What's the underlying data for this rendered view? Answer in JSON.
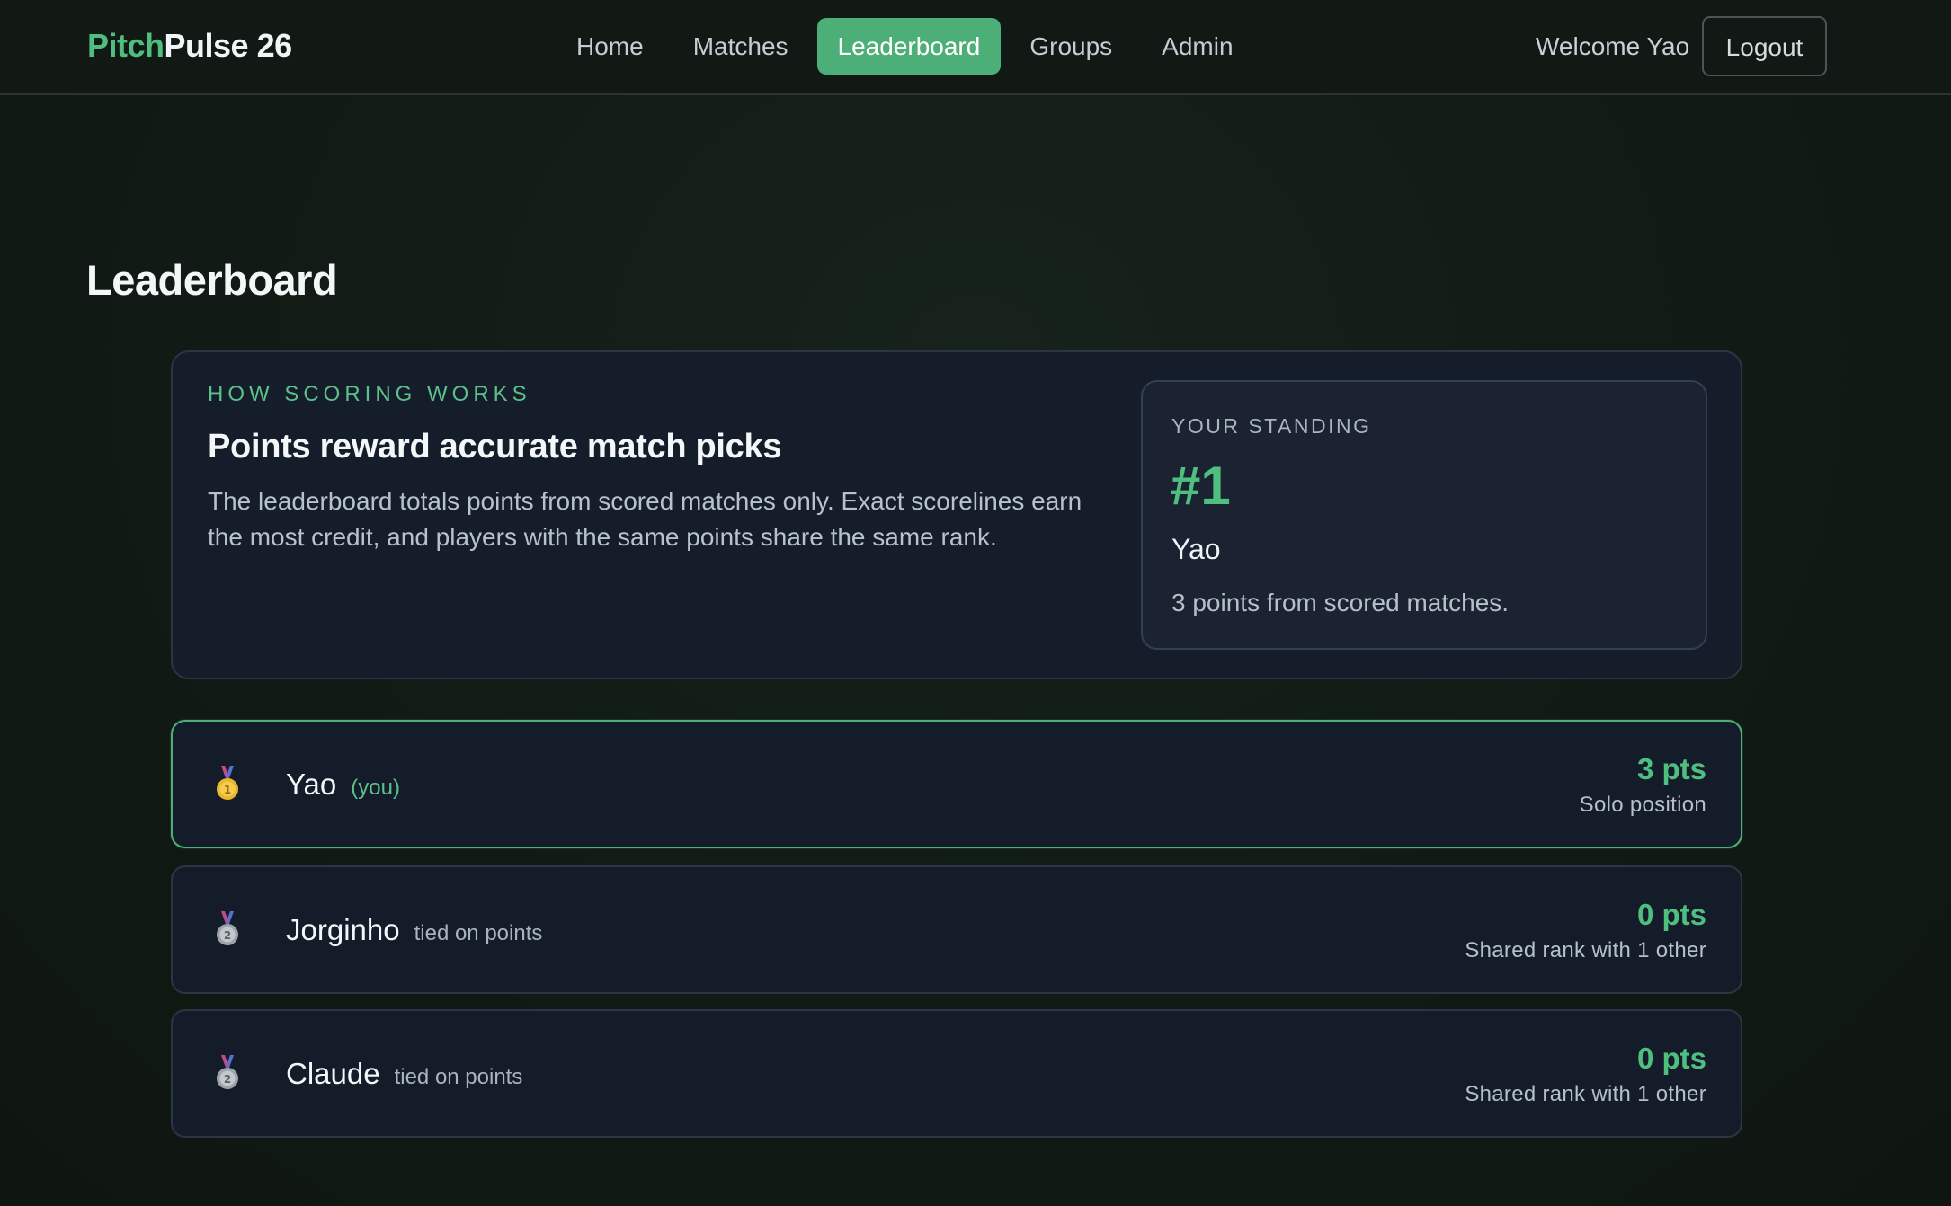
{
  "brand": {
    "part1": "Pitch",
    "part2": "Pulse 26"
  },
  "nav": {
    "items": [
      {
        "label": "Home"
      },
      {
        "label": "Matches"
      },
      {
        "label": "Leaderboard",
        "active": true
      },
      {
        "label": "Groups"
      },
      {
        "label": "Admin"
      }
    ]
  },
  "user": {
    "welcome": "Welcome Yao",
    "logout_label": "Logout"
  },
  "page": {
    "title": "Leaderboard"
  },
  "scoring": {
    "eyebrow": "HOW SCORING WORKS",
    "heading": "Points reward accurate match picks",
    "body": "The leaderboard totals points from scored matches only. Exact scorelines earn the most credit, and players with the same points share the same rank."
  },
  "standing": {
    "label": "YOUR STANDING",
    "rank": "#1",
    "name": "Yao",
    "summary": "3 points from scored matches."
  },
  "leaderboard": {
    "rows": [
      {
        "medal": "gold-medal-icon",
        "name": "Yao",
        "tag": "(you)",
        "points": "3 pts",
        "note": "Solo position"
      },
      {
        "medal": "silver-medal-icon",
        "name": "Jorginho",
        "tag": "tied on points",
        "points": "0 pts",
        "note": "Shared rank with 1 other"
      },
      {
        "medal": "silver-medal-icon",
        "name": "Claude",
        "tag": "tied on points",
        "points": "0 pts",
        "note": "Shared rank with 1 other"
      }
    ]
  },
  "colors": {
    "accent": "#4caf78",
    "background": "#121a14",
    "card": "#151c2a",
    "gold": "#e8b730",
    "silver": "#a9aeb3"
  }
}
